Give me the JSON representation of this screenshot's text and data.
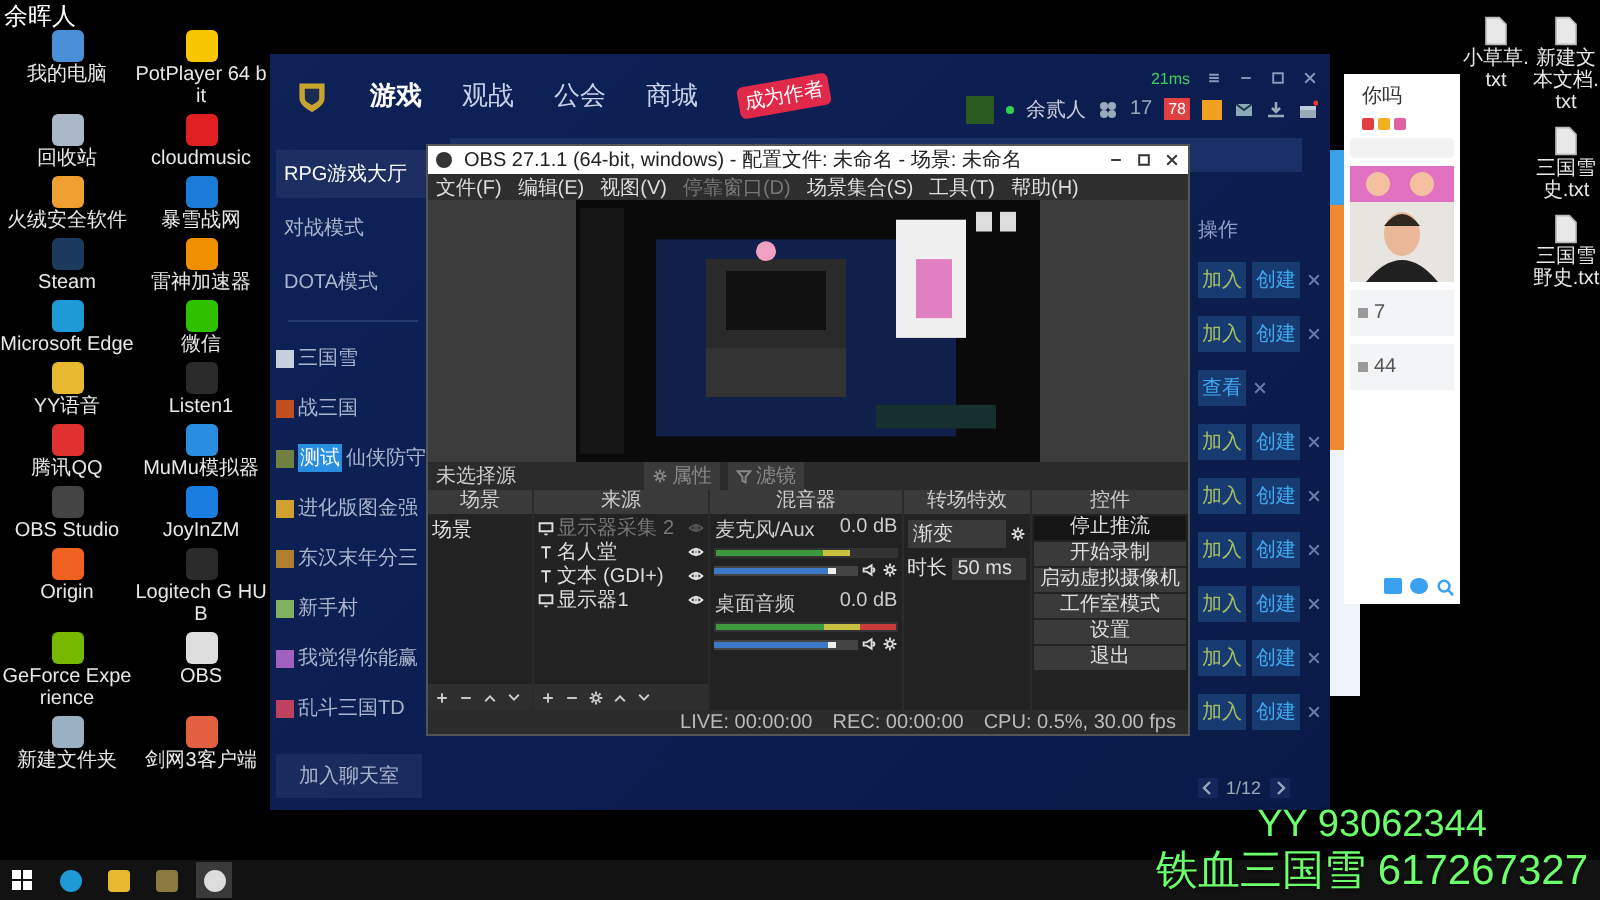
{
  "desktop": {
    "caption": "余晖人",
    "icons": [
      {
        "label": "我的电脑"
      },
      {
        "label": "PotPlayer 64 bit"
      },
      {
        "label": "回收站"
      },
      {
        "label": "cloudmusic"
      },
      {
        "label": "火绒安全软件"
      },
      {
        "label": "暴雪战网"
      },
      {
        "label": "Steam"
      },
      {
        "label": "雷神加速器"
      },
      {
        "label": "Microsoft Edge"
      },
      {
        "label": "微信"
      },
      {
        "label": "YY语音"
      },
      {
        "label": "Listen1"
      },
      {
        "label": "腾讯QQ"
      },
      {
        "label": "MuMu模拟器"
      },
      {
        "label": "OBS Studio"
      },
      {
        "label": "JoyInZM"
      },
      {
        "label": "Origin"
      },
      {
        "label": "Logitech G HUB"
      },
      {
        "label": "GeForce Experience"
      },
      {
        "label": "OBS"
      },
      {
        "label": "新建文件夹"
      },
      {
        "label": "剑网3客户端"
      }
    ],
    "file_columns": [
      [
        {
          "label": "小草草.txt"
        }
      ],
      [
        {
          "label": "新建文本文档.txt"
        },
        {
          "label": "三国雪史.txt"
        },
        {
          "label": "三国雪野史.txt"
        }
      ]
    ]
  },
  "launcher": {
    "ping": "21ms",
    "nav": [
      {
        "label": "游戏",
        "selected": true
      },
      {
        "label": "观战",
        "selected": false
      },
      {
        "label": "公会",
        "selected": false
      },
      {
        "label": "商城",
        "selected": false
      }
    ],
    "promo": "成为作者",
    "user": "余贰人",
    "friends": "17",
    "badge": "78",
    "modes": [
      {
        "label": "RPG游戏大厅",
        "selected": true
      },
      {
        "label": "对战模式",
        "selected": false
      },
      {
        "label": "DOTA模式",
        "selected": false
      }
    ],
    "maps": [
      {
        "label": "三国雪"
      },
      {
        "label": "战三国"
      },
      {
        "label": "仙侠防守",
        "tag": "测试"
      },
      {
        "label": "进化版图金强"
      },
      {
        "label": "东汉末年分三"
      },
      {
        "label": "新手村"
      },
      {
        "label": "我觉得你能赢"
      },
      {
        "label": "乱斗三国TD"
      }
    ],
    "chat_button": "加入聊天室",
    "actions_header": "操作",
    "rows": [
      {
        "actions": [
          {
            "kind": "join",
            "label": "加入"
          },
          {
            "kind": "create",
            "label": "创建"
          }
        ]
      },
      {
        "actions": [
          {
            "kind": "join",
            "label": "加入"
          },
          {
            "kind": "create",
            "label": "创建"
          }
        ]
      },
      {
        "actions": [
          {
            "kind": "view",
            "label": "查看"
          }
        ]
      },
      {
        "actions": [
          {
            "kind": "join",
            "label": "加入"
          },
          {
            "kind": "create",
            "label": "创建"
          }
        ]
      },
      {
        "actions": [
          {
            "kind": "join",
            "label": "加入"
          },
          {
            "kind": "create",
            "label": "创建"
          }
        ]
      },
      {
        "actions": [
          {
            "kind": "join",
            "label": "加入"
          },
          {
            "kind": "create",
            "label": "创建"
          }
        ]
      },
      {
        "actions": [
          {
            "kind": "join",
            "label": "加入"
          },
          {
            "kind": "create",
            "label": "创建"
          }
        ]
      },
      {
        "actions": [
          {
            "kind": "join",
            "label": "加入"
          },
          {
            "kind": "create",
            "label": "创建"
          }
        ]
      },
      {
        "actions": [
          {
            "kind": "join",
            "label": "加入"
          },
          {
            "kind": "create",
            "label": "创建"
          }
        ]
      }
    ],
    "page": "1/12"
  },
  "obs": {
    "title": "OBS 27.1.1 (64-bit, windows) - 配置文件: 未命名 - 场景: 未命名",
    "menu": [
      {
        "label": "文件(F)",
        "disabled": false
      },
      {
        "label": "编辑(E)",
        "disabled": false
      },
      {
        "label": "视图(V)",
        "disabled": false
      },
      {
        "label": "停靠窗口(D)",
        "disabled": true
      },
      {
        "label": "场景集合(S)",
        "disabled": false
      },
      {
        "label": "工具(T)",
        "disabled": false
      },
      {
        "label": "帮助(H)",
        "disabled": false
      }
    ],
    "source_status": "未选择源",
    "source_buttons": [
      {
        "kind": "properties",
        "label": "属性"
      },
      {
        "kind": "filters",
        "label": "滤镜"
      }
    ],
    "scenes": {
      "title": "场景",
      "items": [
        "场景"
      ]
    },
    "sources": {
      "title": "来源",
      "items": [
        {
          "kind": "monitor",
          "label": "显示器采集 2",
          "visible": false
        },
        {
          "kind": "text",
          "label": "名人堂",
          "visible": true
        },
        {
          "kind": "text",
          "label": "文本 (GDI+)",
          "visible": true
        },
        {
          "kind": "monitor",
          "label": "显示器1",
          "visible": true
        }
      ]
    },
    "mixer": {
      "title": "混音器",
      "channels": [
        {
          "name": "麦克风/Aux",
          "reading": "0.0 dB",
          "meter": {
            "level": 0.75
          },
          "fader": {
            "level": 0.85
          }
        },
        {
          "name": "桌面音频",
          "reading": "0.0 dB",
          "meter": {
            "level": 1
          },
          "fader": {
            "level": 0.85
          }
        }
      ]
    },
    "transitions": {
      "title": "转场特效",
      "type": "渐变",
      "duration_label": "时长",
      "duration": "50 ms"
    },
    "controls": {
      "title": "控件",
      "buttons": [
        {
          "label": "停止推流",
          "active": true
        },
        {
          "label": "开始录制",
          "active": false
        },
        {
          "label": "启动虚拟摄像机",
          "active": false
        },
        {
          "label": "工作室模式",
          "active": false
        },
        {
          "label": "设置",
          "active": false
        },
        {
          "label": "退出",
          "active": false
        }
      ]
    },
    "status": {
      "live": "LIVE: 00:00:00",
      "rec": "REC: 00:00:00",
      "cpu": "CPU: 0.5%, 30.00 fps"
    }
  },
  "chat": {
    "title": "你吗",
    "counts": [
      "7",
      "44"
    ]
  },
  "overlay": {
    "lines": [
      "YY 93062344",
      "铁血三国雪 617267327"
    ]
  },
  "taskbar": {
    "apps": [
      {
        "kind": "edge",
        "selected": false
      },
      {
        "kind": "yy",
        "selected": false
      },
      {
        "kind": "game",
        "selected": false
      },
      {
        "kind": "obs",
        "selected": true
      }
    ]
  }
}
